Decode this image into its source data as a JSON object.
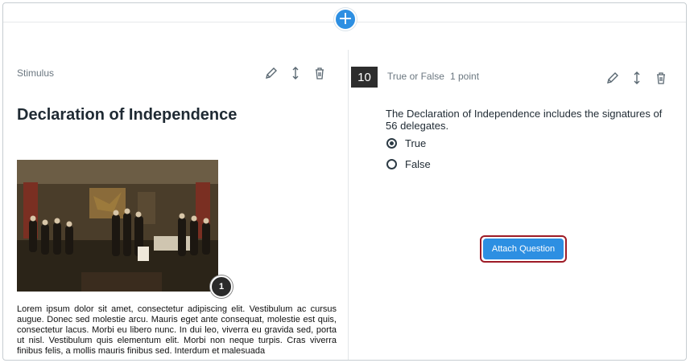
{
  "toolbar": {
    "add_symbol": "+"
  },
  "stimulus": {
    "label": "Stimulus",
    "title": "Declaration of Independence",
    "step_badge": "1",
    "body": "Lorem ipsum dolor sit amet, consectetur adipiscing elit. Vestibulum ac cursus augue. Donec sed molestie arcu. Mauris eget ante consequat, molestie est quis, consectetur lacus. Morbi eu libero nunc. In dui leo, viverra eu gravida sed, porta ut nisl. Vestibulum quis elementum elit. Morbi non neque turpis. Cras viverra finibus felis, a mollis mauris finibus sed. Interdum et malesuada"
  },
  "question": {
    "number": "10",
    "type": "True or False",
    "points": "1 point",
    "text": "The Declaration of Independence includes the signatures of 56 delegates.",
    "options": [
      {
        "label": "True",
        "selected": true
      },
      {
        "label": "False",
        "selected": false
      }
    ],
    "attach_label": "Attach Question"
  },
  "icons": [
    "add-icon",
    "edit-pencil-icon",
    "move-arrows-icon",
    "trash-icon"
  ],
  "colors": {
    "accent": "#2d8fe2",
    "highlight_border": "#9e1b26",
    "badge_dark": "#2d2d2d"
  }
}
